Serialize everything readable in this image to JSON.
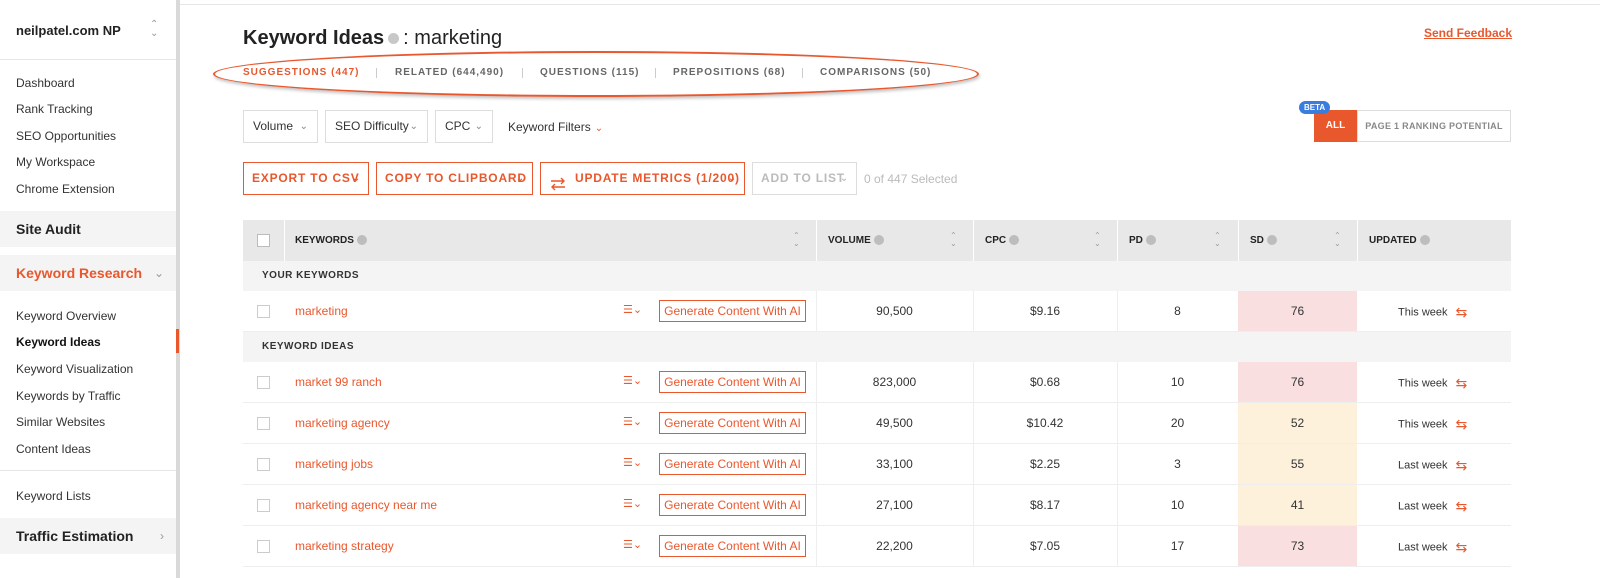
{
  "sidebar": {
    "brand": "neilpatel.com NP",
    "nav_top": [
      "Dashboard",
      "Rank Tracking",
      "SEO Opportunities",
      "My Workspace",
      "Chrome Extension"
    ],
    "site_audit": "Site Audit",
    "keyword_research": "Keyword Research",
    "kr_items": [
      "Keyword Overview",
      "Keyword Ideas",
      "Keyword Visualization",
      "Keywords by Traffic",
      "Similar Websites",
      "Content Ideas"
    ],
    "keyword_lists": "Keyword Lists",
    "traffic_estimation": "Traffic Estimation"
  },
  "header": {
    "title": "Keyword Ideas",
    "query": ": marketing",
    "feedback": "Send Feedback"
  },
  "tabs": [
    "SUGGESTIONS (447)",
    "RELATED (644,490)",
    "QUESTIONS (115)",
    "PREPOSITIONS (68)",
    "COMPARISONS (50)"
  ],
  "filters": {
    "volume": "Volume",
    "seo_difficulty": "SEO Difficulty",
    "cpc": "CPC",
    "keyword_filters": "Keyword Filters",
    "beta": "BETA",
    "all": "ALL",
    "page1": "PAGE 1 RANKING POTENTIAL"
  },
  "actions": {
    "export": "EXPORT TO CSV",
    "copy": "COPY TO CLIPBOARD",
    "update": "UPDATE METRICS (1/200)",
    "add": "ADD TO LIST",
    "selected": "0 of 447 Selected"
  },
  "table": {
    "headers": {
      "keywords": "KEYWORDS",
      "volume": "VOLUME",
      "cpc": "CPC",
      "pd": "PD",
      "sd": "SD",
      "updated": "UPDATED"
    },
    "section_yours": "YOUR KEYWORDS",
    "section_ideas": "KEYWORD IDEAS",
    "generate_label": "Generate Content With AI",
    "rows": [
      {
        "keyword": "marketing",
        "volume": "90,500",
        "cpc": "$9.16",
        "pd": "8",
        "sd": "76",
        "updated": "This week"
      },
      {
        "keyword": "market 99 ranch",
        "volume": "823,000",
        "cpc": "$0.68",
        "pd": "10",
        "sd": "76",
        "updated": "This week"
      },
      {
        "keyword": "marketing agency",
        "volume": "49,500",
        "cpc": "$10.42",
        "pd": "20",
        "sd": "52",
        "updated": "This week"
      },
      {
        "keyword": "marketing jobs",
        "volume": "33,100",
        "cpc": "$2.25",
        "pd": "3",
        "sd": "55",
        "updated": "Last week"
      },
      {
        "keyword": "marketing agency near me",
        "volume": "27,100",
        "cpc": "$8.17",
        "pd": "10",
        "sd": "41",
        "updated": "Last week"
      },
      {
        "keyword": "marketing strategy",
        "volume": "22,200",
        "cpc": "$7.05",
        "pd": "17",
        "sd": "73",
        "updated": "Last week"
      }
    ]
  },
  "colors": {
    "accent": "#e9572d",
    "sd_high": "#f9dfe0",
    "sd_mid": "#fdf1dc",
    "beta": "#3b7ddd"
  }
}
